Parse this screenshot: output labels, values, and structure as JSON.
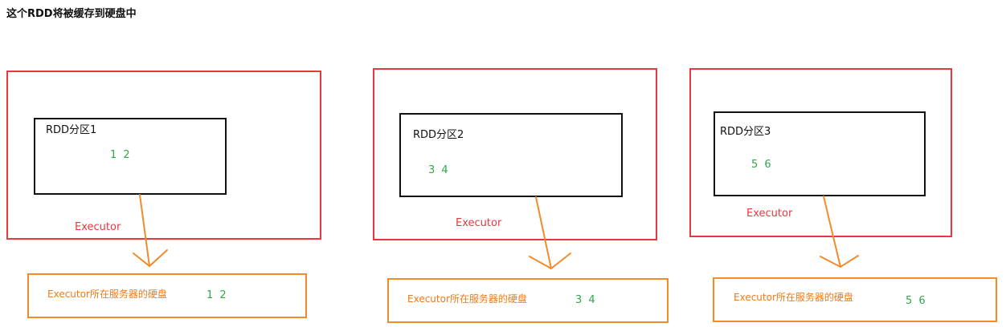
{
  "title": "这个RDD将被缓存到硬盘中",
  "groups": [
    {
      "partition_label": "RDD分区1",
      "values": "1 2",
      "executor_label": "Executor",
      "disk_label": "Executor所在服务器的硬盘",
      "disk_values": "1 2"
    },
    {
      "partition_label": "RDD分区2",
      "values": "3 4",
      "executor_label": "Executor",
      "disk_label": "Executor所在服务器的硬盘",
      "disk_values": "3 4"
    },
    {
      "partition_label": "RDD分区3",
      "values": "5 6",
      "executor_label": "Executor",
      "disk_label": "Executor所在服务器的硬盘",
      "disk_values": "5 6"
    }
  ],
  "colors": {
    "executor": "#e8383d",
    "partition": "#111111",
    "disk": "#f28b2c",
    "values": "#2ea84b"
  }
}
